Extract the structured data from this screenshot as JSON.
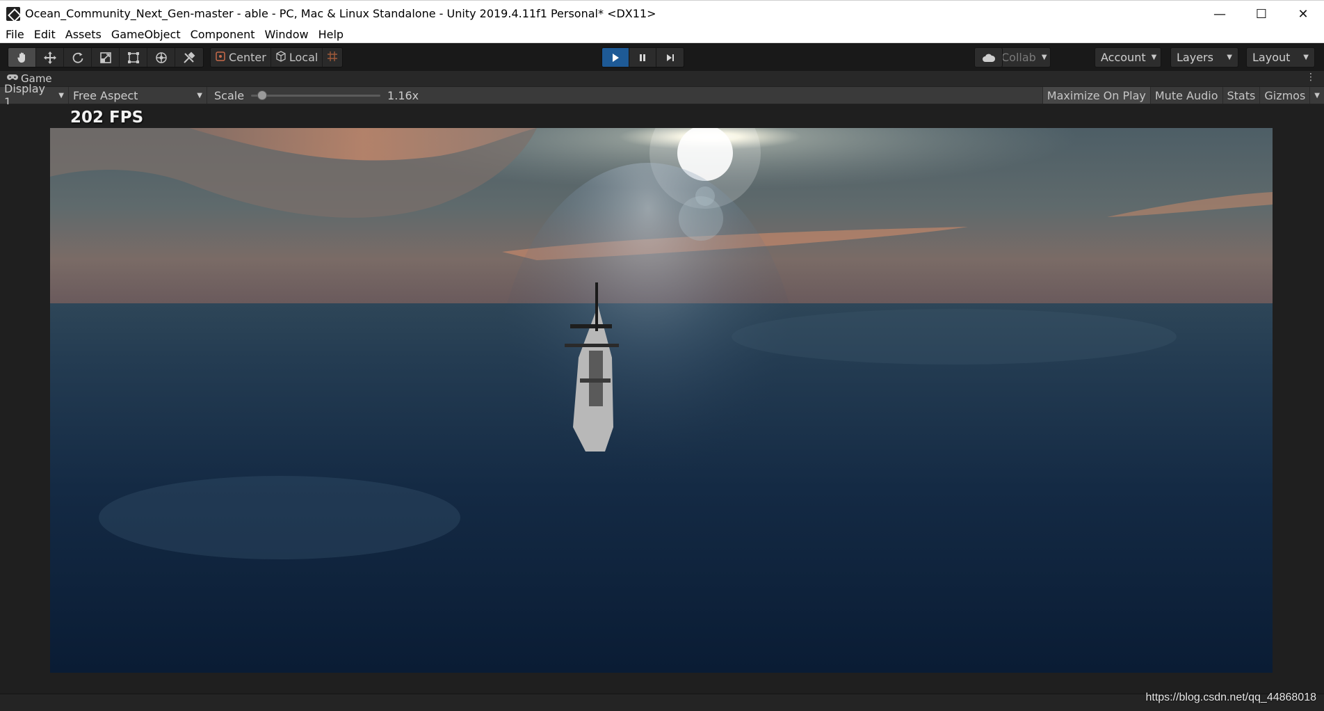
{
  "window": {
    "title": "Ocean_Community_Next_Gen-master - able - PC, Mac & Linux Standalone - Unity 2019.4.11f1 Personal* <DX11>",
    "controls": {
      "minimize": "—",
      "maximize": "☐",
      "close": "✕"
    }
  },
  "menu": {
    "items": [
      "File",
      "Edit",
      "Assets",
      "GameObject",
      "Component",
      "Window",
      "Help"
    ]
  },
  "toolbar": {
    "tools": [
      "hand-icon",
      "move-icon",
      "rotate-icon",
      "scale-icon",
      "rect-transform-icon",
      "transform-icon",
      "custom-tool-icon"
    ],
    "pivot": {
      "center_label": "Center",
      "local_label": "Local"
    },
    "collab_label": "Collab",
    "account_label": "Account",
    "layers_label": "Layers",
    "layout_label": "Layout",
    "play_state": "playing"
  },
  "game_tab": {
    "label": "Game"
  },
  "game_toolbar": {
    "display": "Display 1",
    "aspect": "Free Aspect",
    "scale_label": "Scale",
    "scale_value": "1.16x",
    "scale_fraction": 0.05,
    "buttons": {
      "maximize": "Maximize On Play",
      "mute": "Mute Audio",
      "stats": "Stats",
      "gizmos": "Gizmos"
    }
  },
  "scene": {
    "fps_label": "202 FPS"
  },
  "watermark": "https://blog.csdn.net/qq_44868018",
  "colors": {
    "play_active": "#1e5a96",
    "toolbar_bg": "#191919",
    "sea_dark": "#0e2036",
    "sky_orange": "#c9896a"
  }
}
